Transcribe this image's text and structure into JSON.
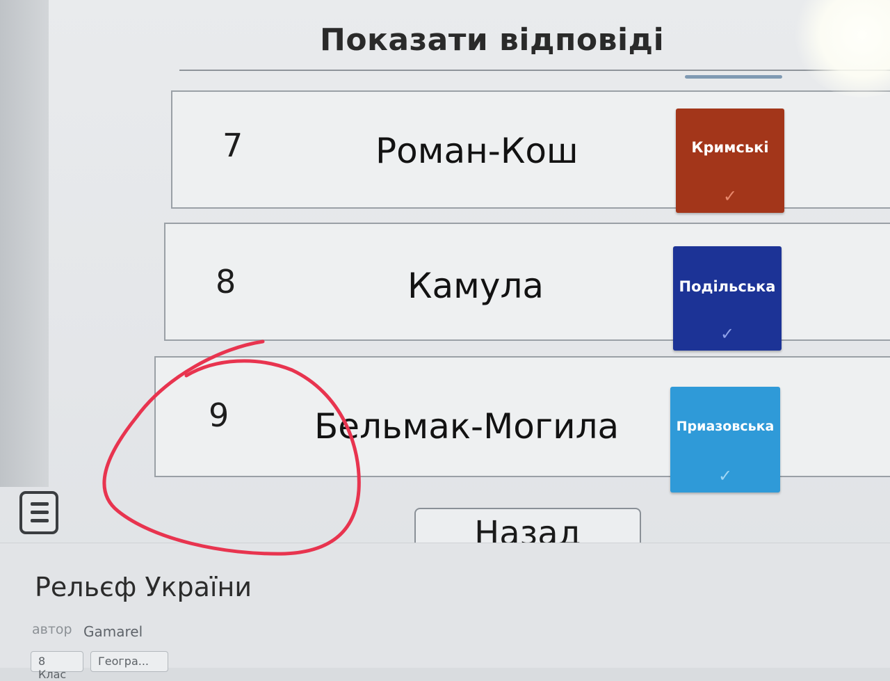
{
  "header": {
    "title": "Показати відповіді"
  },
  "rows": [
    {
      "number": "7",
      "name": "Роман-Кош",
      "region": "Кримські",
      "color": "#a3361a",
      "check": "✓"
    },
    {
      "number": "8",
      "name": "Камула",
      "region": "Подільська",
      "color": "#1c3396",
      "check": "✓"
    },
    {
      "number": "9",
      "name": "Бельмак-Могила",
      "region": "Приазовська",
      "color": "#2f9ad8",
      "check": "✓"
    }
  ],
  "controls": {
    "back_label": "Назад",
    "menu_icon": "hamburger-menu-icon"
  },
  "footer": {
    "title": "Рельєф України",
    "author_label": "автор",
    "author_name": "Gamarel",
    "tags": [
      "8 Клас",
      "Геогра..."
    ]
  },
  "annotation": {
    "color": "#e8344f"
  }
}
